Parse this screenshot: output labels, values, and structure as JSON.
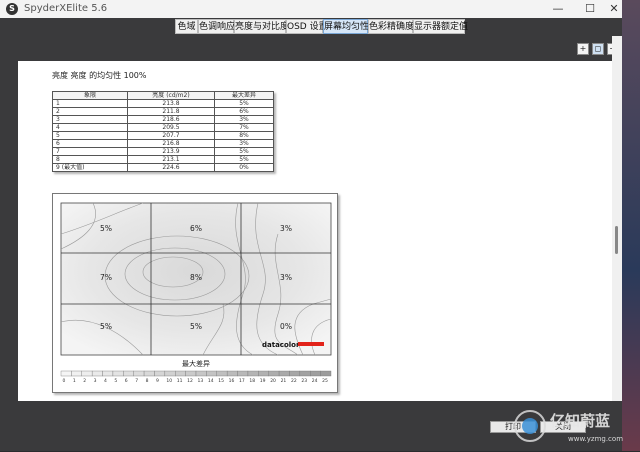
{
  "app": {
    "title": "SpyderXElite 5.6"
  },
  "window_controls": {
    "minimize": "—",
    "maximize": "☐",
    "close": "✕"
  },
  "tabs": [
    {
      "label": "色域",
      "active": false
    },
    {
      "label": "色调响应",
      "active": false
    },
    {
      "label": "亮度与对比度",
      "active": false
    },
    {
      "label": "OSD 设置",
      "active": false
    },
    {
      "label": "屏幕均匀性",
      "active": true
    },
    {
      "label": "色彩精确度",
      "active": false
    },
    {
      "label": "显示器额定值",
      "active": false
    }
  ],
  "zoom": {
    "zoom_in": "+",
    "zoom_fit": "◻",
    "zoom_out": "−"
  },
  "report": {
    "heading": "亮度 亮度 的均匀性 100%",
    "table": {
      "headers": [
        "象限",
        "亮度 (cd/m2)",
        "最大差异"
      ],
      "rows": [
        [
          "1",
          "213.8",
          "5%"
        ],
        [
          "2",
          "211.8",
          "6%"
        ],
        [
          "3",
          "218.6",
          "3%"
        ],
        [
          "4",
          "209.5",
          "7%"
        ],
        [
          "5",
          "207.7",
          "8%"
        ],
        [
          "6",
          "216.8",
          "3%"
        ],
        [
          "7",
          "213.9",
          "5%"
        ],
        [
          "8",
          "213.1",
          "5%"
        ],
        [
          "9 (最大值)",
          "224.6",
          "0%"
        ]
      ]
    },
    "map": {
      "cells": [
        "5%",
        "6%",
        "3%",
        "7%",
        "8%",
        "3%",
        "5%",
        "5%",
        "0%"
      ],
      "logo": "datacolor",
      "logo_accent": "#e2231a",
      "legend_title": "最大差异",
      "legend_ticks": [
        "0",
        "1",
        "2",
        "3",
        "4",
        "5",
        "6",
        "7",
        "8",
        "9",
        "10",
        "11",
        "12",
        "13",
        "14",
        "15",
        "16",
        "17",
        "18",
        "19",
        "20",
        "21",
        "22",
        "23",
        "24",
        "25"
      ]
    }
  },
  "bottom": {
    "button_left": "打印",
    "button_right": "关闭"
  },
  "watermark": {
    "brand": "亿知蔚蓝",
    "url": "www.yzmg.com"
  }
}
